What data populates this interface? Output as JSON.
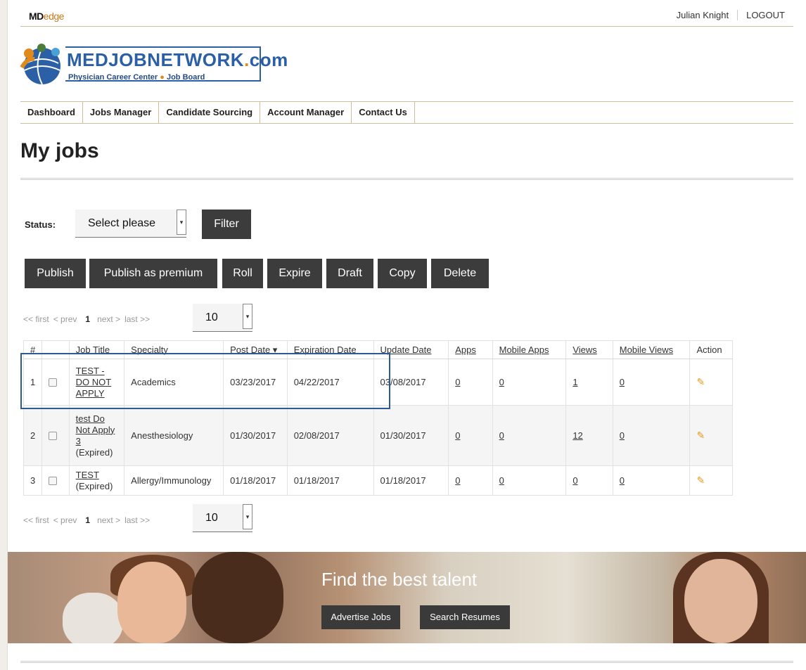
{
  "header": {
    "brand_md": "MD",
    "brand_edge": "edge",
    "user_name": "Julian Knight",
    "logout_label": "LOGOUT"
  },
  "logo": {
    "main_text": "MEDJOBNETWORK",
    "suffix": ".com",
    "suffix_dot": ".",
    "suffix_tld": "com",
    "tagline_1": "Physician Career Center",
    "tagline_bullet": "●",
    "tagline_2": "Job Board"
  },
  "nav": {
    "items": [
      "Dashboard",
      "Jobs Manager",
      "Candidate Sourcing",
      "Account Manager",
      "Contact Us"
    ]
  },
  "page_title": "My jobs",
  "filter": {
    "status_label": "Status:",
    "status_value": "Select please",
    "filter_button": "Filter"
  },
  "actions": [
    "Publish",
    "Publish as premium",
    "Roll",
    "Expire",
    "Draft",
    "Copy",
    "Delete"
  ],
  "pager": {
    "first": "<< first",
    "prev": "< prev",
    "current": "1",
    "next": "next >",
    "last": "last >>",
    "per_page": "10"
  },
  "table": {
    "headers": [
      "#",
      "",
      "Job Title",
      "Specialty",
      "Post Date ▾",
      "Expiration Date",
      "Update Date",
      "Apps",
      "Mobile Apps",
      "Views",
      "Mobile Views",
      "Action"
    ],
    "rows": [
      {
        "num": "1",
        "title": "TEST - DO NOT APPLY",
        "suffix": "",
        "specialty": "Academics",
        "post_date": "03/23/2017",
        "expiration_date": "04/22/2017",
        "update_date": "03/08/2017",
        "apps": "0",
        "mobile_apps": "0",
        "views": "1",
        "mobile_views": "0"
      },
      {
        "num": "2",
        "title": "test Do Not Apply 3",
        "suffix": "(Expired)",
        "specialty": "Anesthesiology",
        "post_date": "01/30/2017",
        "expiration_date": "02/08/2017",
        "update_date": "01/30/2017",
        "apps": "0",
        "mobile_apps": "0",
        "views": "12",
        "mobile_views": "0"
      },
      {
        "num": "3",
        "title": "TEST",
        "suffix": "(Expired)",
        "specialty": "Allergy/Immunology",
        "post_date": "01/18/2017",
        "expiration_date": "01/18/2017",
        "update_date": "01/18/2017",
        "apps": "0",
        "mobile_apps": "0",
        "views": "0",
        "mobile_views": "0"
      }
    ]
  },
  "banner": {
    "title": "Find the best talent",
    "advertise_button": "Advertise Jobs",
    "search_button": "Search Resumes"
  },
  "icons": {
    "edit": "pencil-icon",
    "select_arrow": "caret-down-icon",
    "logo": "globe-icon"
  },
  "colors": {
    "accent_orange": "#e08a1e",
    "logo_blue": "#2b5fa6",
    "button_dark": "#3c3c3c",
    "highlight_blue": "#2e5b95"
  }
}
